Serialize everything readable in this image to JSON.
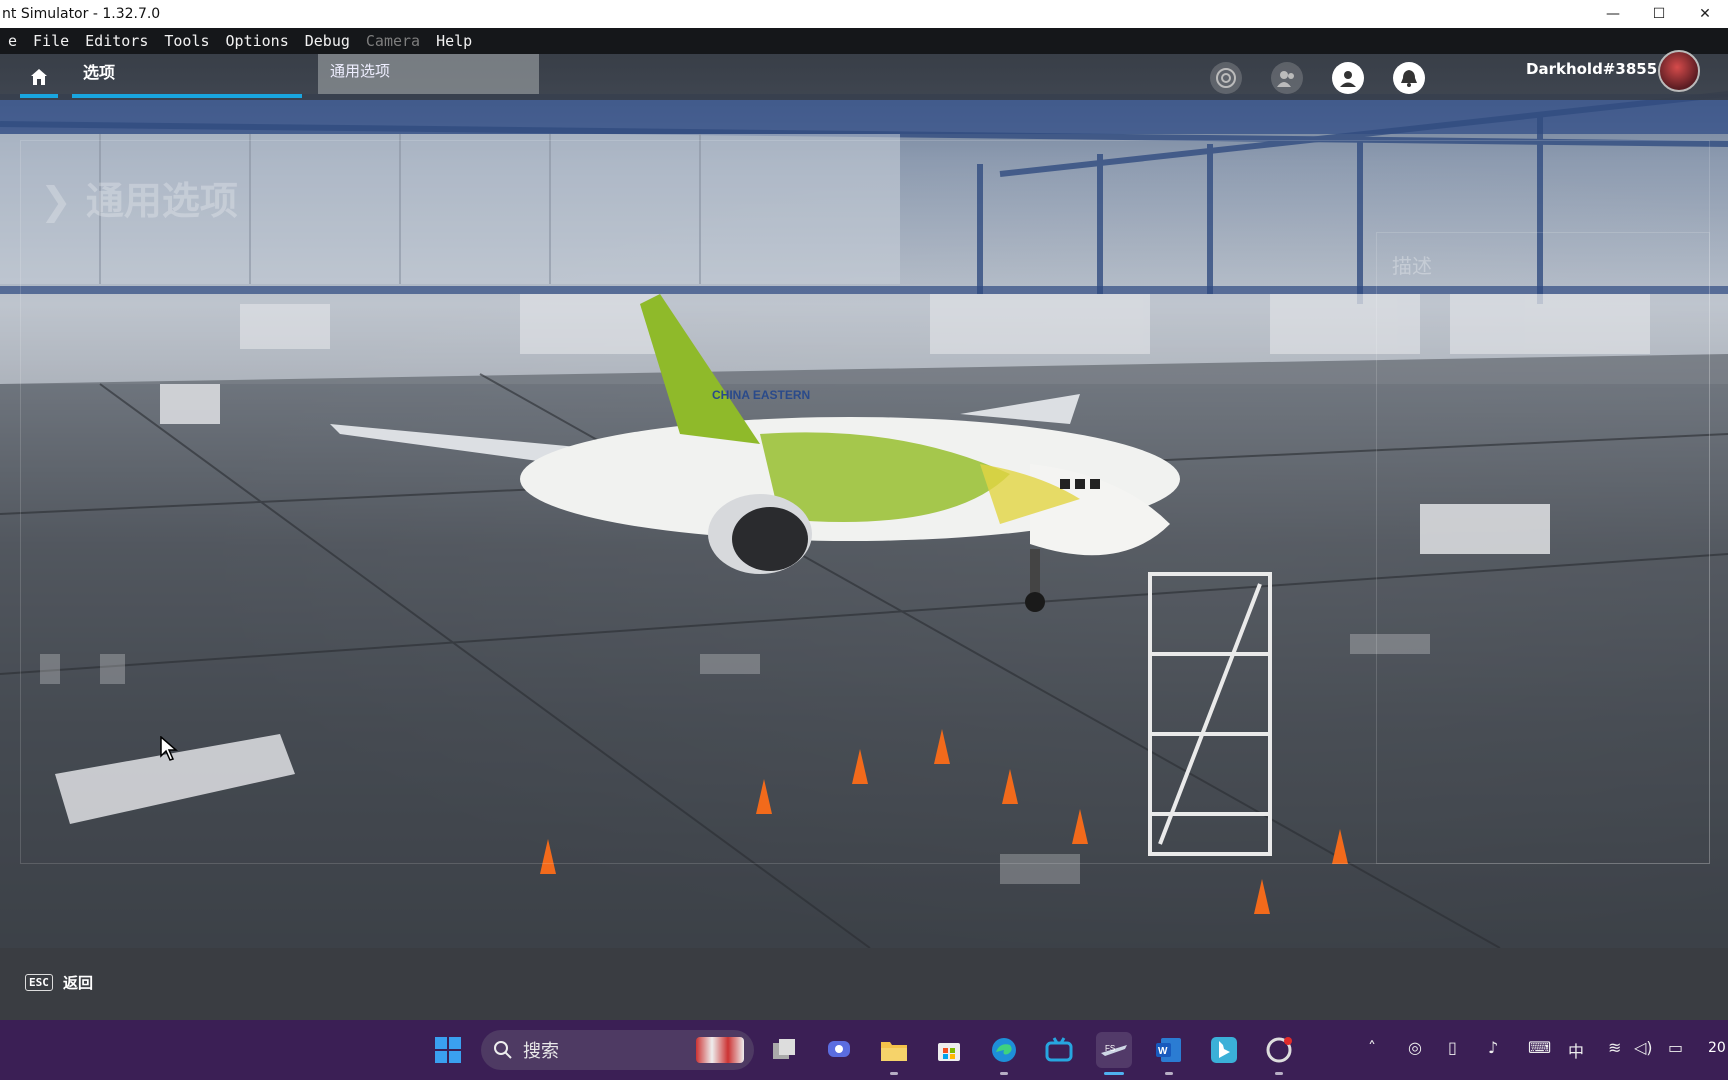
{
  "window": {
    "title": "nt Simulator - 1.32.7.0",
    "minimize": "—",
    "maximize": "☐",
    "close": "✕"
  },
  "menubar": {
    "items": [
      "e",
      "File",
      "Editors",
      "Tools",
      "Options",
      "Debug",
      "Camera",
      "Help"
    ]
  },
  "gamenav": {
    "home_icon": "home-icon",
    "active_tab": "选项",
    "breadcrumb_tab": "通用选项",
    "username": "Darkhold#3855"
  },
  "scene": {
    "ghost_title": "通用选项",
    "ghost_description": "描述",
    "livery_text": "CHINA EASTERN"
  },
  "bottombar": {
    "esc_key": "ESC",
    "back_label": "返回"
  },
  "taskbar": {
    "search_placeholder": "搜索",
    "clock_fragment": "20"
  },
  "colors": {
    "accent": "#19a6e0",
    "taskbar": "#3b1f55"
  }
}
